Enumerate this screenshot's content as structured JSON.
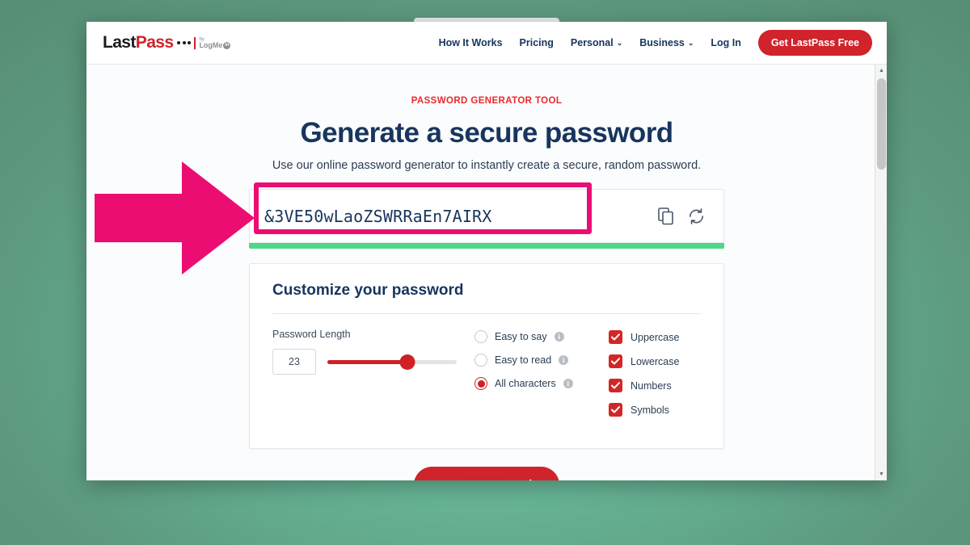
{
  "browser": {
    "scrollbar": {
      "up_arrow": "▲",
      "down_arrow": "▼"
    }
  },
  "header": {
    "logo": {
      "last": "Last",
      "pass": "Pass",
      "by": "by",
      "logmein": "LogMe",
      "in_badge": "in"
    },
    "nav": [
      {
        "label": "How It Works",
        "has_caret": false
      },
      {
        "label": "Pricing",
        "has_caret": false
      },
      {
        "label": "Personal",
        "has_caret": true,
        "caret": "⌄"
      },
      {
        "label": "Business",
        "has_caret": true,
        "caret": "⌄"
      },
      {
        "label": "Log In",
        "has_caret": false
      }
    ],
    "cta_label": "Get LastPass Free"
  },
  "hero": {
    "eyebrow": "PASSWORD GENERATOR TOOL",
    "headline": "Generate a secure password",
    "subhead": "Use our online password generator to instantly create a secure, random password."
  },
  "password_field": {
    "value": "&3VE50wLaoZSWRRaEn7AIRX",
    "length": 23,
    "copy_icon": "copy-icon",
    "refresh_icon": "refresh-icon",
    "strength": "strong",
    "strength_color": "#4ed787"
  },
  "customize": {
    "title": "Customize your password",
    "length_label": "Password Length",
    "length_value": "23",
    "slider_percent": 62,
    "radios": [
      {
        "label": "Easy to say",
        "selected": false,
        "info": "i"
      },
      {
        "label": "Easy to read",
        "selected": false,
        "info": "i"
      },
      {
        "label": "All characters",
        "selected": true,
        "info": "i"
      }
    ],
    "checkboxes": [
      {
        "label": "Uppercase",
        "checked": true
      },
      {
        "label": "Lowercase",
        "checked": true
      },
      {
        "label": "Numbers",
        "checked": true
      },
      {
        "label": "Symbols",
        "checked": true
      }
    ]
  },
  "copy_button": {
    "label": "Copy Password"
  },
  "annotation": {
    "arrow_color": "#ec0d72",
    "highlight_color": "#ec0d72"
  },
  "colors": {
    "brand_red": "#d0232b",
    "navy": "#17355d",
    "page_bg": "#5d9a80"
  }
}
